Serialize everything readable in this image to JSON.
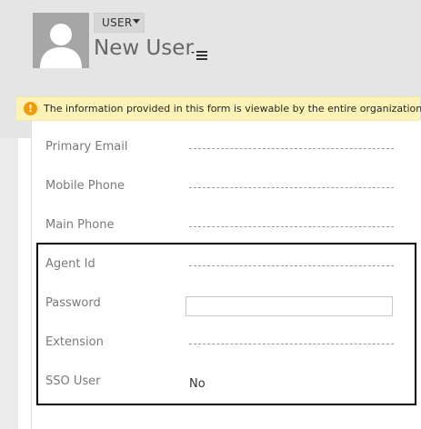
{
  "header": {
    "entity_label": "USER",
    "record_title": "New User"
  },
  "notice": {
    "icon": "warning-icon",
    "text": "The information provided in this form is viewable by the entire organization."
  },
  "fields": {
    "primary_email": {
      "label": "Primary Email",
      "value": ""
    },
    "mobile_phone": {
      "label": "Mobile Phone",
      "value": ""
    },
    "main_phone": {
      "label": "Main Phone",
      "value": ""
    },
    "agent_id": {
      "label": "Agent Id",
      "value": ""
    },
    "password": {
      "label": "Password",
      "value": ""
    },
    "extension": {
      "label": "Extension",
      "value": ""
    },
    "sso_user": {
      "label": "SSO User",
      "value": "No"
    }
  },
  "colors": {
    "notice_background": "#fdf3b6",
    "warning_icon": "#f29b07",
    "header_band": "#e5e5e5"
  }
}
